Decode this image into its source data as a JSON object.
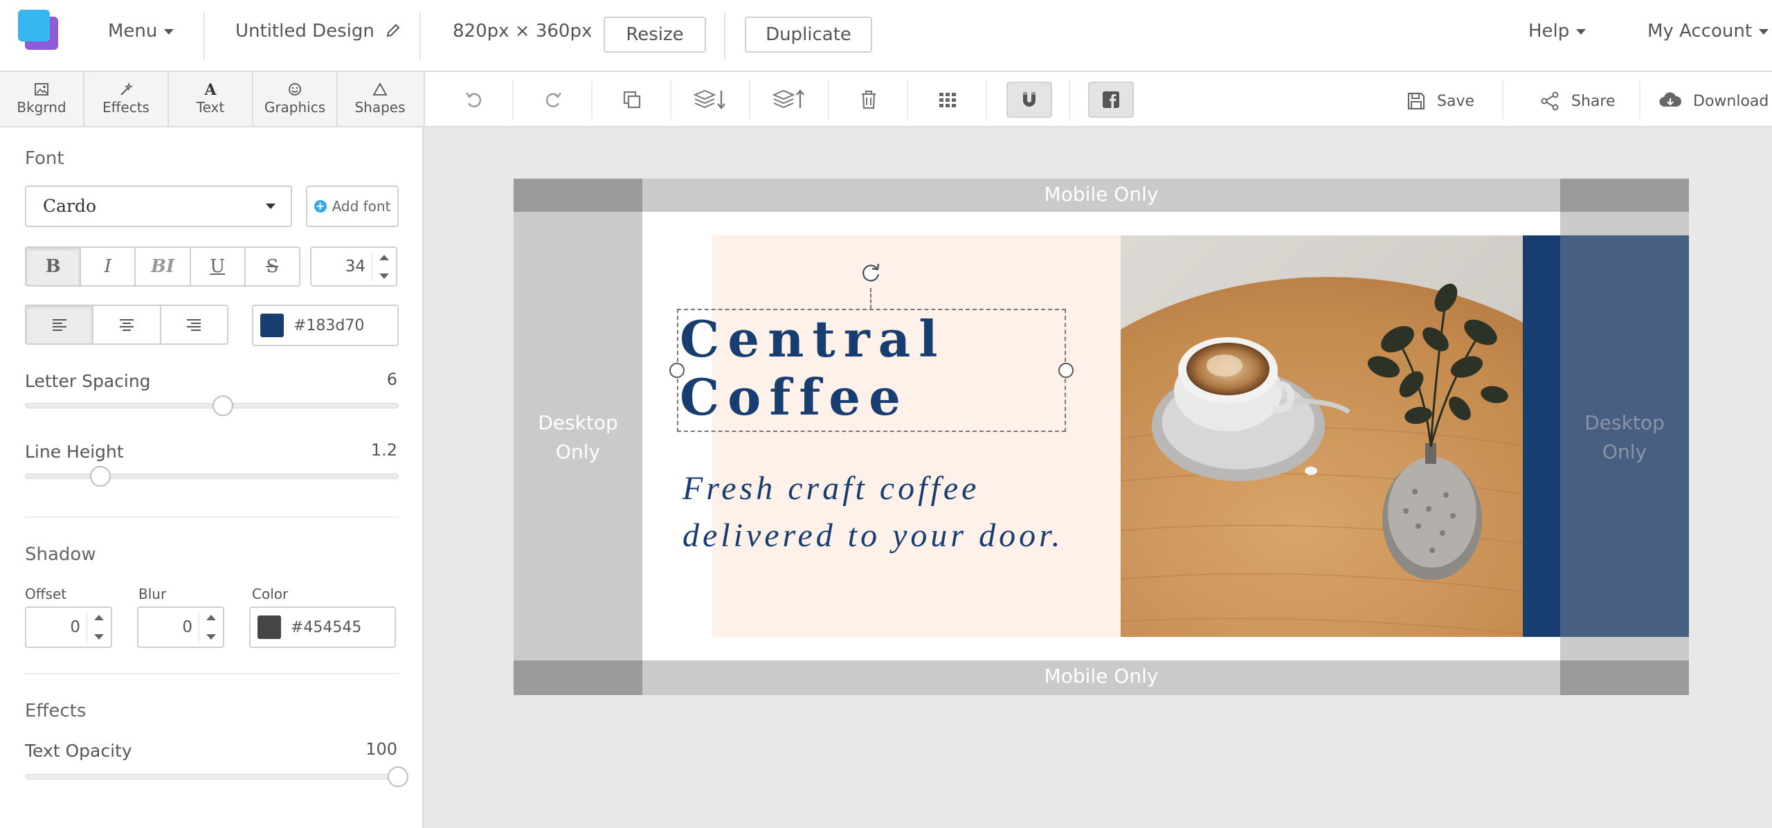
{
  "topbar": {
    "menu_label": "Menu",
    "design_title": "Untitled Design",
    "dimensions": "820px × 360px",
    "resize_label": "Resize",
    "duplicate_label": "Duplicate",
    "help_label": "Help",
    "account_label": "My Account"
  },
  "tool_tabs": [
    {
      "label": "Bkgrnd",
      "icon": "image-icon"
    },
    {
      "label": "Effects",
      "icon": "magic-wand-icon"
    },
    {
      "label": "Text",
      "icon": "text-icon"
    },
    {
      "label": "Graphics",
      "icon": "smiley-icon"
    },
    {
      "label": "Shapes",
      "icon": "triangle-icon"
    }
  ],
  "toolbar": {
    "save_label": "Save",
    "share_label": "Share",
    "download_label": "Download"
  },
  "panel": {
    "font_heading": "Font",
    "font_name": "Cardo",
    "add_font_label": "Add font",
    "style_buttons": [
      "B",
      "I",
      "BI",
      "U",
      "S"
    ],
    "font_size": "34",
    "text_color_hex": "#183d70",
    "letter_spacing_label": "Letter Spacing",
    "letter_spacing_value": "6",
    "letter_spacing_fraction": 0.53,
    "line_height_label": "Line Height",
    "line_height_value": "1.2",
    "line_height_fraction": 0.2,
    "shadow_heading": "Shadow",
    "offset_label": "Offset",
    "offset_value": "0",
    "blur_label": "Blur",
    "blur_value": "0",
    "shadow_color_label": "Color",
    "shadow_color_hex": "#454545",
    "effects_heading": "Effects",
    "text_opacity_label": "Text Opacity",
    "text_opacity_value": "100",
    "text_opacity_fraction": 1.0
  },
  "canvas": {
    "mobile_top_label": "Mobile Only",
    "mobile_bottom_label": "Mobile Only",
    "desktop_left_label": "Desktop Only",
    "desktop_right_label": "Desktop Only",
    "headline_line1": "Central",
    "headline_line2": "Coffee",
    "tagline_line1": "Fresh craft coffee",
    "tagline_line2": "delivered to your door."
  },
  "colors": {
    "brand_navy": "#183d70",
    "peach": "#fdf1e9",
    "logo_blue": "#38b6f0",
    "logo_purple": "#8f5bd8",
    "guide_gray": "#cacaca"
  }
}
